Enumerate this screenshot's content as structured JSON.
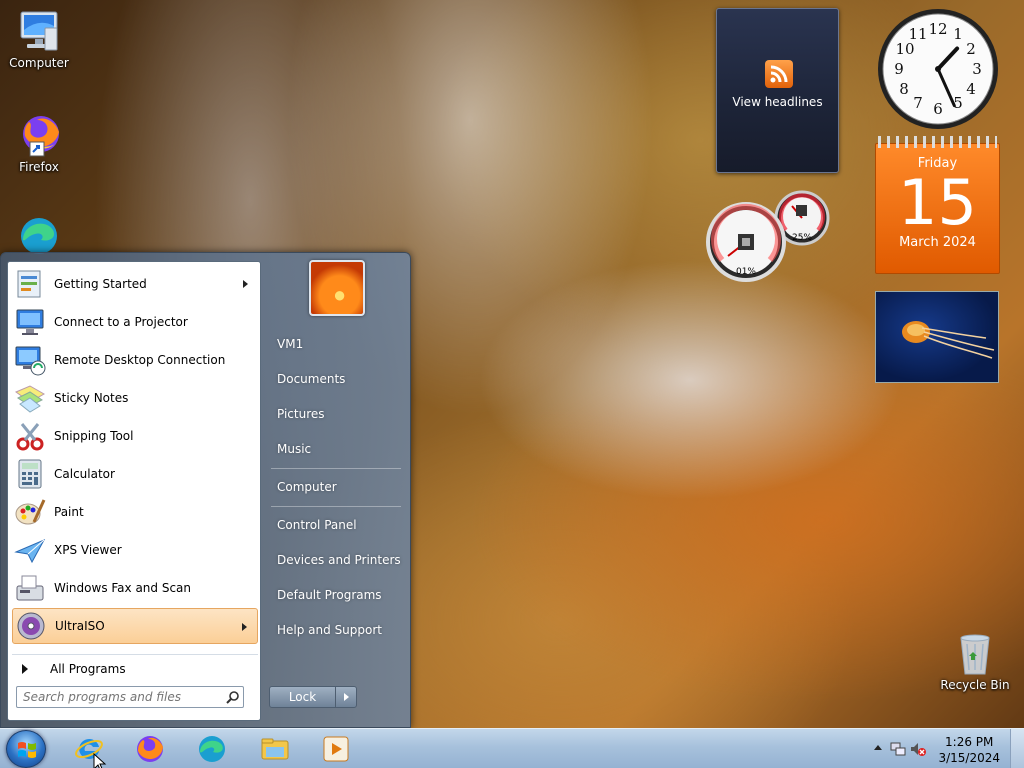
{
  "desktop": {
    "icons": [
      {
        "label": "Computer",
        "icon": "computer-icon"
      },
      {
        "label": "Firefox",
        "icon": "firefox-icon"
      },
      {
        "label": "",
        "icon": "edge-icon"
      },
      {
        "label": "Recycle Bin",
        "icon": "recycle-bin-icon"
      }
    ]
  },
  "gadgets": {
    "feed": {
      "label": "View headlines",
      "icon": "rss-icon"
    },
    "clock": {
      "hour": 1,
      "minute": 26
    },
    "calendar": {
      "weekday": "Friday",
      "day": "15",
      "month_year": "March 2024"
    },
    "cpu_meter": {
      "cpu": "01%",
      "memory": "25%"
    },
    "slideshow": {
      "icon": "jellyfish-photo"
    }
  },
  "start_menu": {
    "programs": [
      {
        "label": "Getting Started",
        "icon": "getting-started-icon",
        "has_submenu": true
      },
      {
        "label": "Connect to a Projector",
        "icon": "projector-icon",
        "has_submenu": false
      },
      {
        "label": "Remote Desktop Connection",
        "icon": "remote-desktop-icon",
        "has_submenu": false
      },
      {
        "label": "Sticky Notes",
        "icon": "sticky-notes-icon",
        "has_submenu": false
      },
      {
        "label": "Snipping Tool",
        "icon": "snipping-tool-icon",
        "has_submenu": false
      },
      {
        "label": "Calculator",
        "icon": "calculator-icon",
        "has_submenu": false
      },
      {
        "label": "Paint",
        "icon": "paint-icon",
        "has_submenu": false
      },
      {
        "label": "XPS Viewer",
        "icon": "xps-viewer-icon",
        "has_submenu": false
      },
      {
        "label": "Windows Fax and Scan",
        "icon": "fax-scan-icon",
        "has_submenu": false
      },
      {
        "label": "UltraISO",
        "icon": "ultraiso-icon",
        "has_submenu": true,
        "selected": true
      }
    ],
    "all_programs": "All Programs",
    "search": {
      "placeholder": "Search programs and files",
      "value": ""
    },
    "right_links": [
      {
        "label": "VM1"
      },
      {
        "label": "Documents"
      },
      {
        "label": "Pictures"
      },
      {
        "label": "Music"
      },
      {
        "label": "Computer"
      },
      {
        "label": "Control Panel"
      },
      {
        "label": "Devices and Printers"
      },
      {
        "label": "Default Programs"
      },
      {
        "label": "Help and Support"
      }
    ],
    "lock_label": "Lock"
  },
  "taskbar": {
    "apps": [
      {
        "icon": "internet-explorer-icon"
      },
      {
        "icon": "firefox-icon"
      },
      {
        "icon": "edge-icon"
      },
      {
        "icon": "file-explorer-icon"
      },
      {
        "icon": "media-player-icon"
      }
    ],
    "tray": {
      "time": "1:26 PM",
      "date": "3/15/2024"
    }
  },
  "colors": {
    "accent": "#2c72c4",
    "selected_item": "#fbcf97",
    "calendar": "#f07010"
  }
}
